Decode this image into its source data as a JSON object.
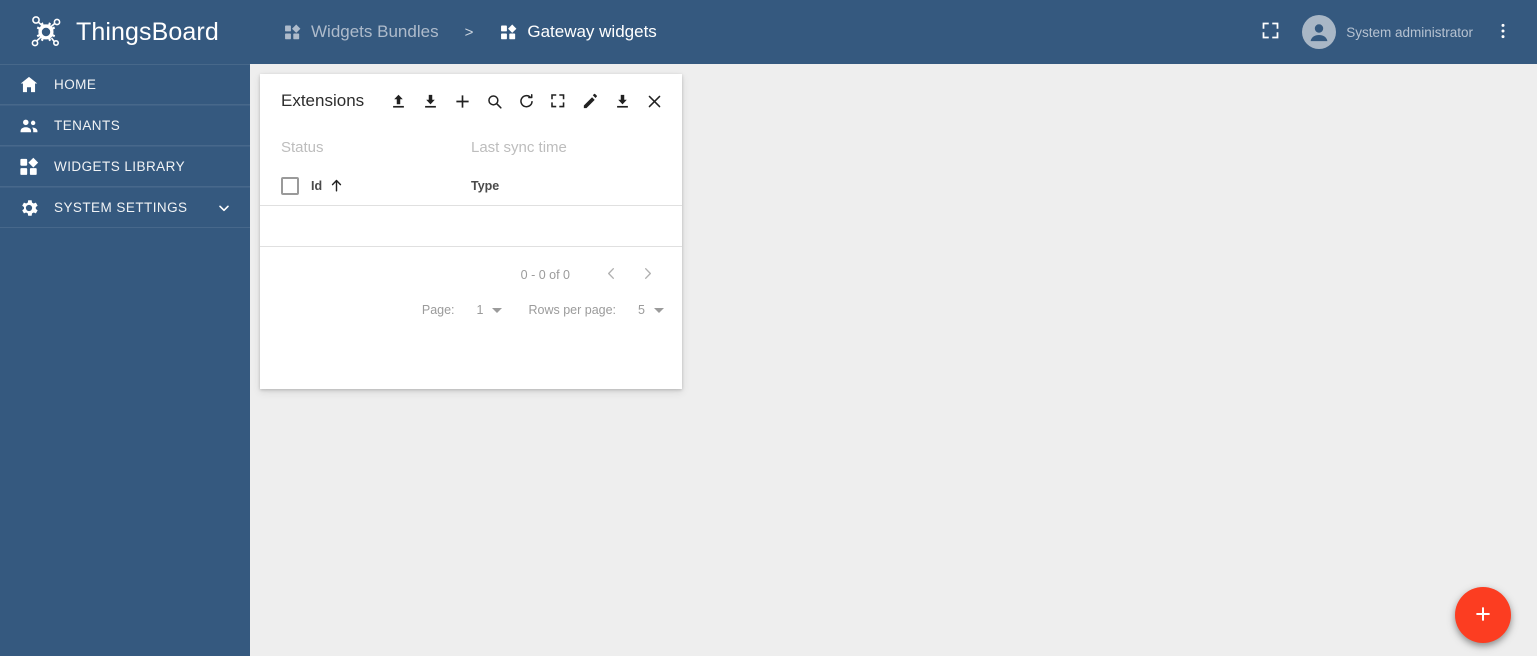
{
  "brand": {
    "name": "ThingsBoard",
    "logo_icon": "thingsboard-gear-logo"
  },
  "sidebar": {
    "items": [
      {
        "label": "HOME",
        "icon": "home-icon",
        "expandable": false
      },
      {
        "label": "TENANTS",
        "icon": "people-icon",
        "expandable": false
      },
      {
        "label": "WIDGETS LIBRARY",
        "icon": "widgets-icon",
        "expandable": false
      },
      {
        "label": "SYSTEM SETTINGS",
        "icon": "gear-icon",
        "expandable": true
      }
    ]
  },
  "topbar": {
    "breadcrumb": [
      {
        "label": "Widgets Bundles",
        "icon": "widgets-icon",
        "active": false
      },
      {
        "label": "Gateway widgets",
        "icon": "widgets-icon",
        "active": true
      }
    ],
    "separator": ">",
    "fullscreen_icon": "fullscreen-icon",
    "user_name": "System administrator",
    "avatar_icon": "account-circle-icon",
    "more_icon": "more-vertical-icon"
  },
  "card": {
    "title": "Extensions",
    "actions": [
      {
        "name": "upload-extensions",
        "icon": "upload-icon"
      },
      {
        "name": "download-extensions",
        "icon": "download-icon"
      },
      {
        "name": "add-extension",
        "icon": "plus-icon"
      },
      {
        "name": "search-extensions",
        "icon": "search-icon"
      },
      {
        "name": "refresh-extensions",
        "icon": "refresh-icon"
      },
      {
        "name": "fullscreen-widget",
        "icon": "fullscreen-icon"
      },
      {
        "name": "edit-widget",
        "icon": "pencil-icon"
      },
      {
        "name": "export-widget",
        "icon": "download-icon"
      },
      {
        "name": "close-widget",
        "icon": "close-icon"
      }
    ],
    "table": {
      "meta_labels": {
        "status": "Status",
        "last_sync_time": "Last sync time"
      },
      "columns": [
        {
          "label": "Id",
          "sorted": true,
          "sort_direction": "asc"
        },
        {
          "label": "Type",
          "sorted": false
        }
      ],
      "rows": []
    },
    "paginator": {
      "range_label": "0 - 0 of 0",
      "prev_icon": "chevron-left-icon",
      "next_icon": "chevron-right-icon",
      "page_label": "Page:",
      "page_value": "1",
      "rows_per_page_label": "Rows per page:",
      "rows_per_page_value": "5"
    }
  },
  "fab": {
    "icon": "plus-icon",
    "color": "#fc3d21"
  },
  "colors": {
    "primary": "#35597f",
    "accent": "#fc3d21",
    "background": "#eeeeee",
    "surface": "#ffffff",
    "muted_text": "#bdbdbd"
  }
}
